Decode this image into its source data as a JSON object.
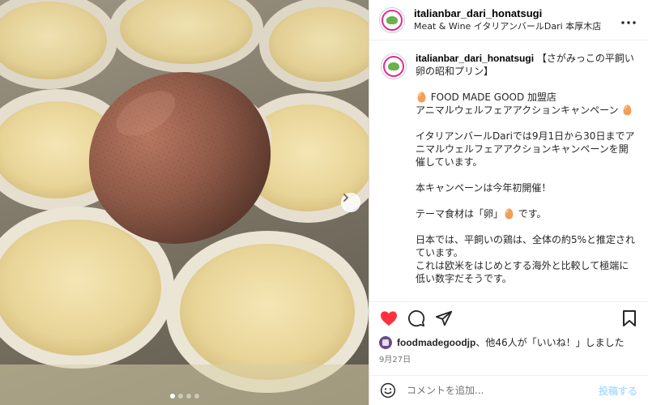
{
  "post": {
    "next_icon": "chevron-right-icon",
    "carousel": {
      "total": 4,
      "active": 1
    }
  },
  "header": {
    "username": "italianbar_dari_honatsugi",
    "subtitle": "Meat & Wine イタリアンバールDari 本厚木店",
    "more_icon": "more-horizontal-icon"
  },
  "caption": {
    "username": "italianbar_dari_honatsugi",
    "title": "【さがみっこの平飼い卵の昭和プリン】",
    "line1": "🥚 FOOD MADE GOOD 加盟店",
    "line2": "アニマルウェルフェアアクションキャンペーン 🥚",
    "para2": "イタリアンバールDariでは9月1日から30日までアニマルウェルフェアアクションキャンペーンを開催しています。",
    "para3": "本キャンペーンは今年初開催！",
    "para4": "テーマ食材は「卵」🥚 です。",
    "para5_a": "日本では、平飼いの鶏は、全体の約5%と推定されています。",
    "para5_b": "これは欧米をはじめとする海外と比較して極端に低い数字だそうです。"
  },
  "actions": {
    "like_icon": "heart-filled-icon",
    "comment_icon": "comment-icon",
    "share_icon": "paper-plane-icon",
    "save_icon": "bookmark-icon",
    "like_color": "#ff3040"
  },
  "likes": {
    "user": "foodmadegoodjp",
    "text": "、他46人が「いいね！」しました"
  },
  "date": "9月27日",
  "comment": {
    "placeholder": "コメントを追加...",
    "post_label": "投稿する",
    "emoji_icon": "smiley-icon"
  }
}
